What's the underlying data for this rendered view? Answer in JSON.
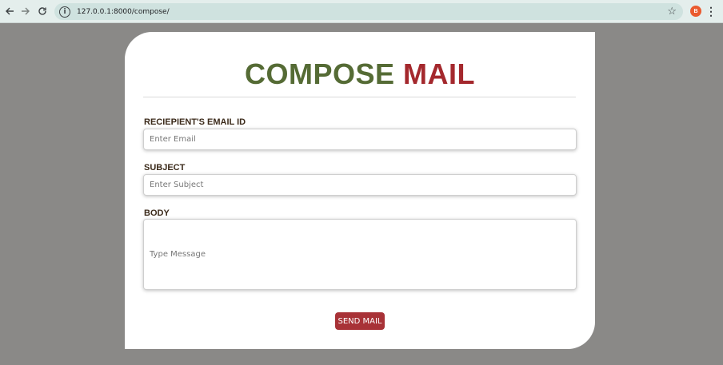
{
  "browser": {
    "url": "127.0.0.1:8000/compose/",
    "profile_initial": "B",
    "icons": {
      "back": "arrow-left-icon",
      "forward": "arrow-right-icon",
      "reload": "reload-icon",
      "site_info": "info-icon",
      "bookmark": "star-icon",
      "menu": "kebab-menu-icon"
    }
  },
  "page": {
    "title_word1": "COMPOSE",
    "title_word2": "MAIL",
    "colors": {
      "title_word1": "#556b35",
      "title_word2": "#a4282d",
      "button": "#a83237",
      "background": "#8a8987"
    }
  },
  "form": {
    "email_label": "RECIEPIENT'S EMAIL ID",
    "email_placeholder": "Enter Email",
    "subject_label": "SUBJECT",
    "subject_placeholder": "Enter Subject",
    "body_label": "BODY",
    "body_placeholder": "Type Message",
    "send_label": "SEND MAIL"
  }
}
